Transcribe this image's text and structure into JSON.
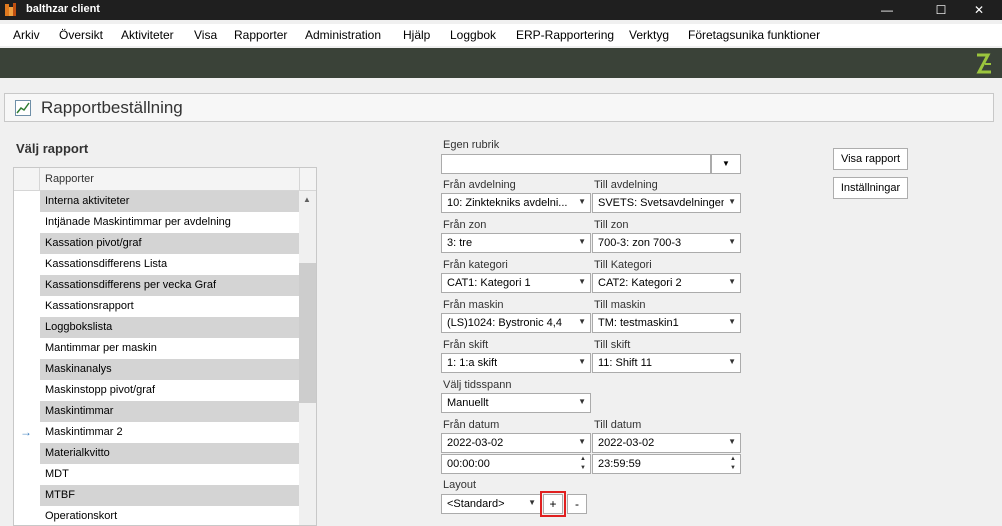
{
  "window": {
    "title": "balthzar client",
    "app_icon": "balthzar-app-icon",
    "minimize": "—",
    "maximize": "☐",
    "close": "✕"
  },
  "menu": [
    "Arkiv",
    "Översikt",
    "Aktiviteter",
    "Visa",
    "Rapporter",
    "Administration",
    "Hjälp",
    "Loggbok",
    "ERP-Rapportering",
    "Verktyg",
    "Företagsunika funktioner"
  ],
  "header": {
    "title": "Rapportbeställning",
    "icon": "report-chart-icon"
  },
  "report_list": {
    "label": "Välj rapport",
    "column_header": "Rapporter",
    "current_row_index": 11,
    "rows": [
      "Interna aktiviteter",
      "Intjänade Maskintimmar per avdelning",
      "Kassation pivot/graf",
      "Kassationsdifferens Lista",
      "Kassationsdifferens per vecka Graf",
      "Kassationsrapport",
      "Loggbokslista",
      "Mantimmar per maskin",
      "Maskinanalys",
      "Maskinstopp pivot/graf",
      "Maskintimmar",
      "Maskintimmar 2",
      "Materialkvitto",
      "MDT",
      "MTBF",
      "Operationskort"
    ]
  },
  "form": {
    "egen_rubrik": {
      "label": "Egen rubrik",
      "value": ""
    },
    "fran_avdelning": {
      "label": "Från avdelning",
      "value": "10: Zinktekniks avdelni..."
    },
    "till_avdelning": {
      "label": "Till avdelning",
      "value": "SVETS: Svetsavdelningen"
    },
    "fran_zon": {
      "label": "Från zon",
      "value": "3: tre"
    },
    "till_zon": {
      "label": "Till zon",
      "value": "700-3: zon 700-3"
    },
    "fran_kategori": {
      "label": "Från kategori",
      "value": "CAT1: Kategori 1"
    },
    "till_kategori": {
      "label": "Till Kategori",
      "value": "CAT2: Kategori 2"
    },
    "fran_maskin": {
      "label": "Från maskin",
      "value": "(LS)1024: Bystronic 4,4"
    },
    "till_maskin": {
      "label": "Till maskin",
      "value": "TM: testmaskin1"
    },
    "fran_skift": {
      "label": "Från skift",
      "value": "1: 1:a skift"
    },
    "till_skift": {
      "label": "Till skift",
      "value": "11: Shift 11"
    },
    "tidsspann": {
      "label": "Välj tidsspann",
      "value": "Manuellt"
    },
    "fran_datum": {
      "label": "Från datum",
      "date": "2022-03-02",
      "time": "00:00:00"
    },
    "till_datum": {
      "label": "Till datum",
      "date": "2022-03-02",
      "time": "23:59:59"
    },
    "layout": {
      "label": "Layout",
      "value": "<Standard>",
      "add": "+",
      "remove": "-"
    }
  },
  "buttons": {
    "visa_rapport": "Visa rapport",
    "installningar": "Inställningar"
  }
}
